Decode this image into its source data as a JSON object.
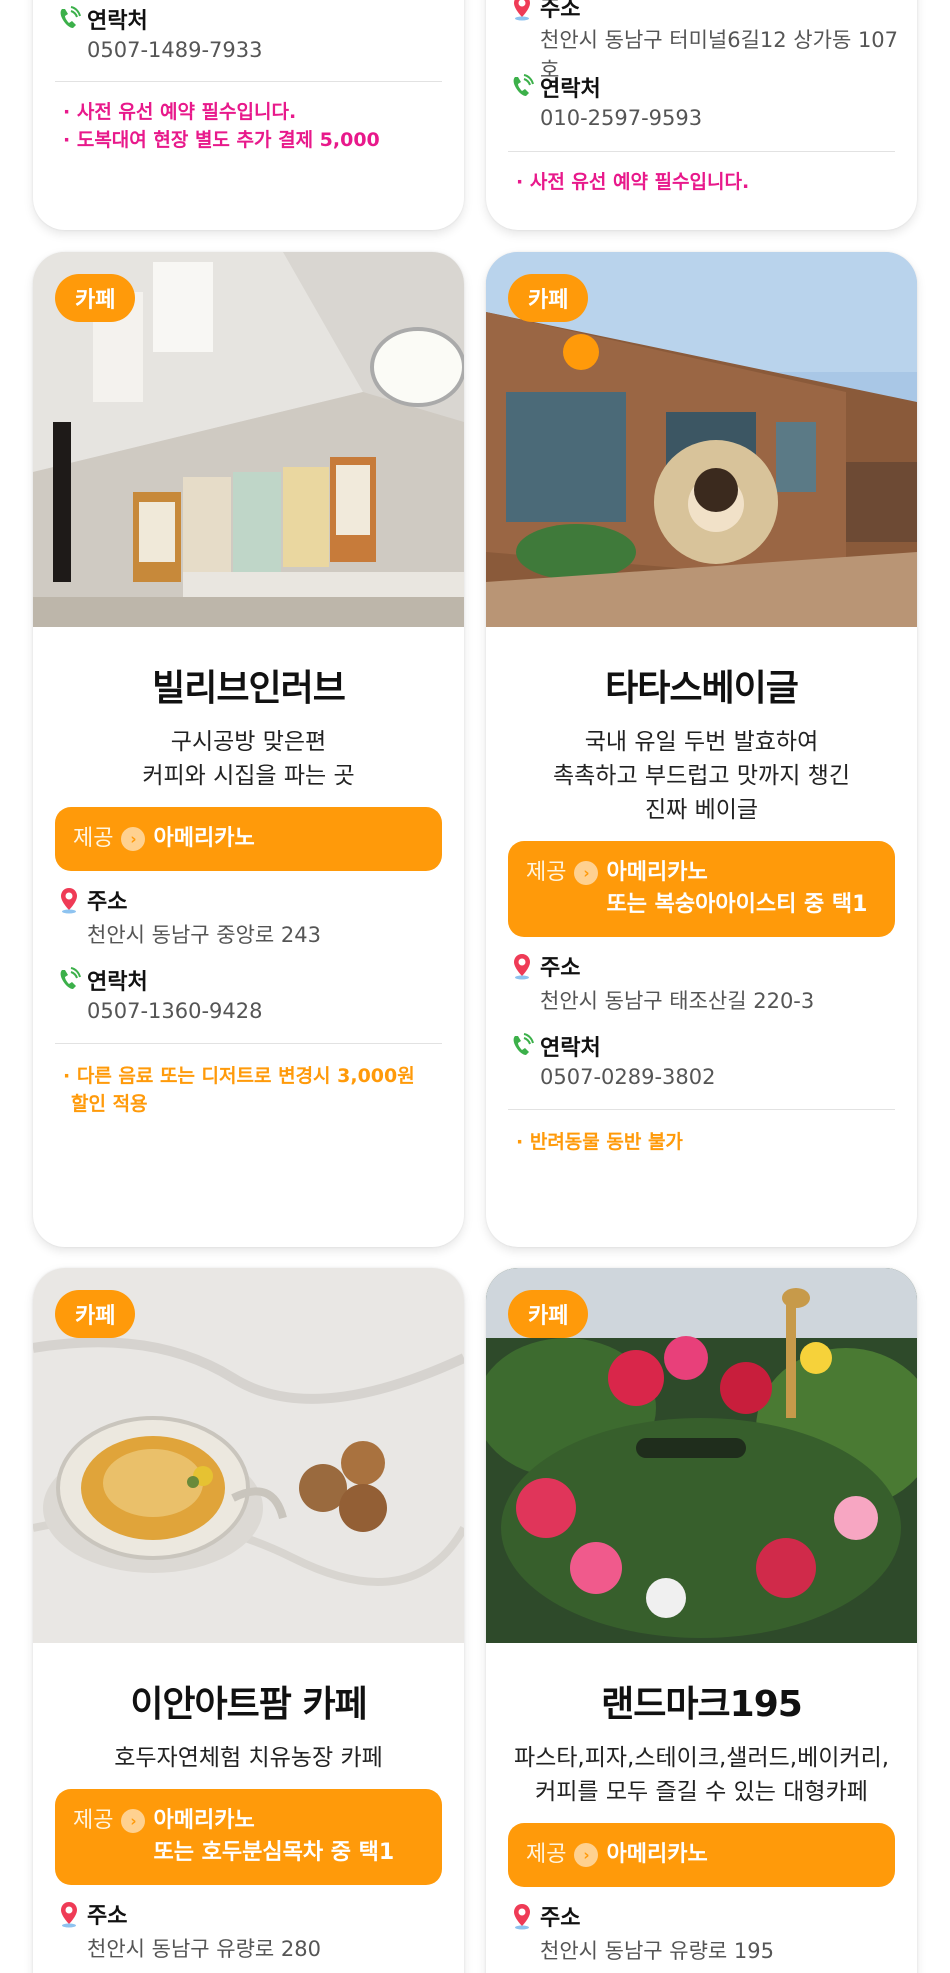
{
  "top_cards": [
    {
      "contact_label": "연락처",
      "contact_value": "0507-1489-7933",
      "notes": [
        "· 사전 유선 예약 필수입니다.",
        "· 도복대여 현장 별도 추가 결제 5,000"
      ],
      "notes_color": "#e8198b"
    },
    {
      "address_label": "주소",
      "address_value": "천안시 동남구 터미널6길12 상가동 107호",
      "contact_label": "연락처",
      "contact_value": "010-2597-9593",
      "notes": [
        "· 사전 유선 예약 필수입니다."
      ],
      "notes_color": "#e8198b"
    }
  ],
  "cards": [
    {
      "badge": "카페",
      "title": "빌리브인러브",
      "desc": [
        "구시공방 맞은편",
        "커피와 시집을 파는 곳"
      ],
      "offer_label": "제공",
      "offer_lines": [
        "아메리카노"
      ],
      "address_label": "주소",
      "address_value": "천안시 동남구 중앙로 243",
      "contact_label": "연락처",
      "contact_value": "0507-1360-9428",
      "notes": [
        "· 다른 음료 또는 디저트로 변경시 3,000원",
        "할인 적용"
      ]
    },
    {
      "badge": "카페",
      "title": "타타스베이글",
      "desc": [
        "국내 유일 두번 발효하여",
        "촉촉하고 부드럽고 맛까지 챙긴",
        "진짜 베이글"
      ],
      "offer_label": "제공",
      "offer_lines": [
        "아메리카노",
        "또는 복숭아아이스티 중 택1"
      ],
      "address_label": "주소",
      "address_value": "천안시 동남구 태조산길 220-3",
      "contact_label": "연락처",
      "contact_value": "0507-0289-3802",
      "notes": [
        "· 반려동물 동반 불가"
      ]
    },
    {
      "badge": "카페",
      "title": "이안아트팜 카페",
      "desc": [
        "호두자연체험 치유농장 카페"
      ],
      "offer_label": "제공",
      "offer_lines": [
        "아메리카노",
        "또는 호두분심목차 중 택1"
      ],
      "address_label": "주소",
      "address_value": "천안시 동남구 유량로 280"
    },
    {
      "badge": "카페",
      "title": "랜드마크195",
      "desc": [
        "파스타,피자,스테이크,샐러드,베이커리,",
        "커피를 모두 즐길 수 있는 대형카페"
      ],
      "offer_label": "제공",
      "offer_lines": [
        "아메리카노"
      ],
      "address_label": "주소",
      "address_value": "천안시 동남구 유량로 195"
    }
  ],
  "colors": {
    "accent": "#ff9a0a",
    "pink_note": "#e8198b",
    "orange_note": "#ff9a0a"
  },
  "icons": {
    "address": "map-pin-icon",
    "contact": "phone-icon",
    "offer": "chevron-right-circle-icon"
  }
}
